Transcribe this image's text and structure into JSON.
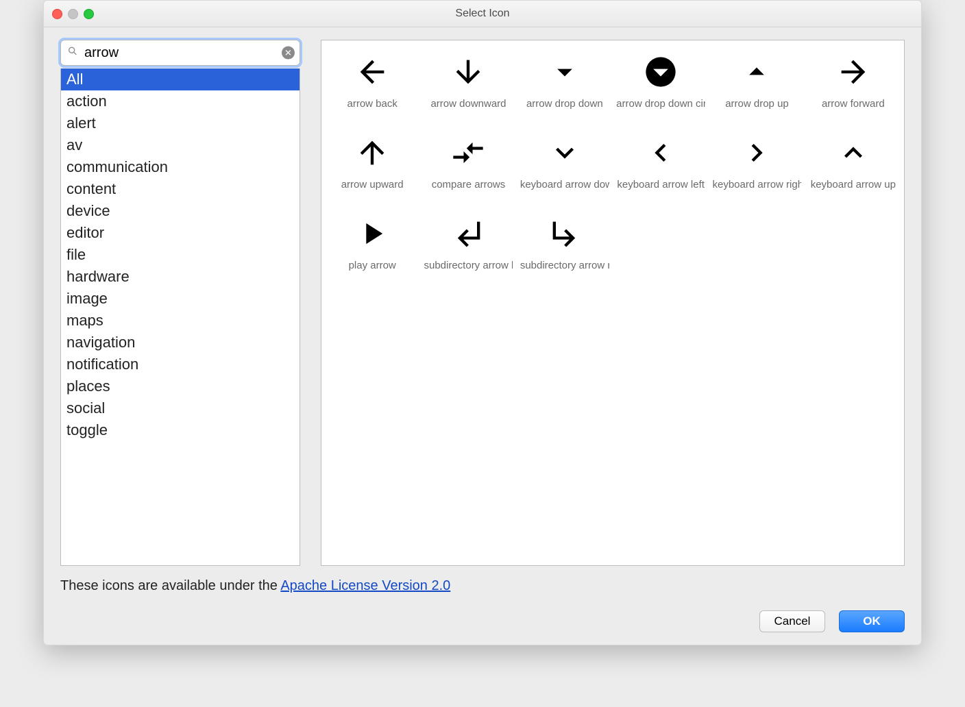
{
  "window": {
    "title": "Select Icon"
  },
  "search": {
    "value": "arrow"
  },
  "categories": {
    "selected_index": 0,
    "items": [
      "All",
      "action",
      "alert",
      "av",
      "communication",
      "content",
      "device",
      "editor",
      "file",
      "hardware",
      "image",
      "maps",
      "navigation",
      "notification",
      "places",
      "social",
      "toggle"
    ]
  },
  "icons": [
    {
      "name": "arrow back",
      "glyph": "arrow-back"
    },
    {
      "name": "arrow downward",
      "glyph": "arrow-downward"
    },
    {
      "name": "arrow drop down",
      "glyph": "arrow-drop-down"
    },
    {
      "name": "arrow drop down circle",
      "glyph": "arrow-drop-down-circle"
    },
    {
      "name": "arrow drop up",
      "glyph": "arrow-drop-up"
    },
    {
      "name": "arrow forward",
      "glyph": "arrow-forward"
    },
    {
      "name": "arrow upward",
      "glyph": "arrow-upward"
    },
    {
      "name": "compare arrows",
      "glyph": "compare-arrows"
    },
    {
      "name": "keyboard arrow down",
      "glyph": "keyboard-arrow-down"
    },
    {
      "name": "keyboard arrow left",
      "glyph": "keyboard-arrow-left"
    },
    {
      "name": "keyboard arrow right",
      "glyph": "keyboard-arrow-right"
    },
    {
      "name": "keyboard arrow up",
      "glyph": "keyboard-arrow-up"
    },
    {
      "name": "play arrow",
      "glyph": "play-arrow"
    },
    {
      "name": "subdirectory arrow left",
      "glyph": "subdir-left"
    },
    {
      "name": "subdirectory arrow right",
      "glyph": "subdir-right"
    }
  ],
  "footer": {
    "license_prefix": "These icons are available under the ",
    "license_link_text": "Apache License Version 2.0"
  },
  "buttons": {
    "cancel": "Cancel",
    "ok": "OK"
  }
}
